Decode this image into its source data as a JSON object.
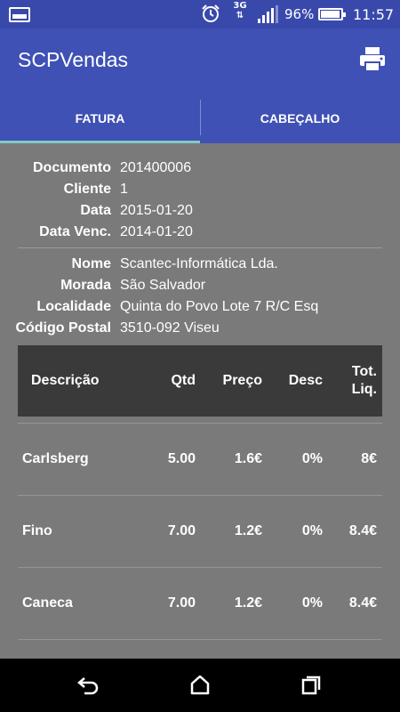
{
  "status_bar": {
    "network": "3G",
    "battery": "96%",
    "time": "11:57"
  },
  "app": {
    "title": "SCPVendas",
    "colors": {
      "app_bar": "#3f51b5",
      "tab_indicator": "#80cbc4",
      "background": "#7a7a7a"
    }
  },
  "tabs": [
    {
      "label": "FATURA",
      "active": true
    },
    {
      "label": "CABEÇALHO",
      "active": false
    }
  ],
  "document": [
    {
      "label": "Documento",
      "value": "201400006"
    },
    {
      "label": "Cliente",
      "value": "1"
    },
    {
      "label": "Data",
      "value": "2015-01-20"
    },
    {
      "label": "Data Venc.",
      "value": "2014-01-20"
    }
  ],
  "customer": [
    {
      "label": "Nome",
      "value": "Scantec-Informática  Lda."
    },
    {
      "label": "Morada",
      "value": "São Salvador"
    },
    {
      "label": "Localidade",
      "value": "Quinta do Povo  Lote 7 R/C Esq"
    },
    {
      "label": "Código Postal",
      "value": "3510-092 Viseu"
    }
  ],
  "table": {
    "headers": {
      "desc": "Descrição",
      "qtd": "Qtd",
      "preco": "Preço",
      "desconto": "Desc",
      "tot_line1": "Tot.",
      "tot_line2": "Liq."
    },
    "rows": [
      {
        "desc": "Carlsberg",
        "qtd": "5.00",
        "preco": "1.6€",
        "desconto": "0%",
        "tot": "8€"
      },
      {
        "desc": "Fino",
        "qtd": "7.00",
        "preco": "1.2€",
        "desconto": "0%",
        "tot": "8.4€"
      },
      {
        "desc": "Caneca",
        "qtd": "7.00",
        "preco": "1.2€",
        "desconto": "0%",
        "tot": "8.4€"
      }
    ]
  },
  "icons": {
    "status": [
      "image-icon",
      "alarm-icon",
      "signal-icon",
      "battery-icon"
    ],
    "toolbar": [
      "print-icon"
    ],
    "nav": [
      "back-icon",
      "home-icon",
      "recents-icon"
    ]
  }
}
